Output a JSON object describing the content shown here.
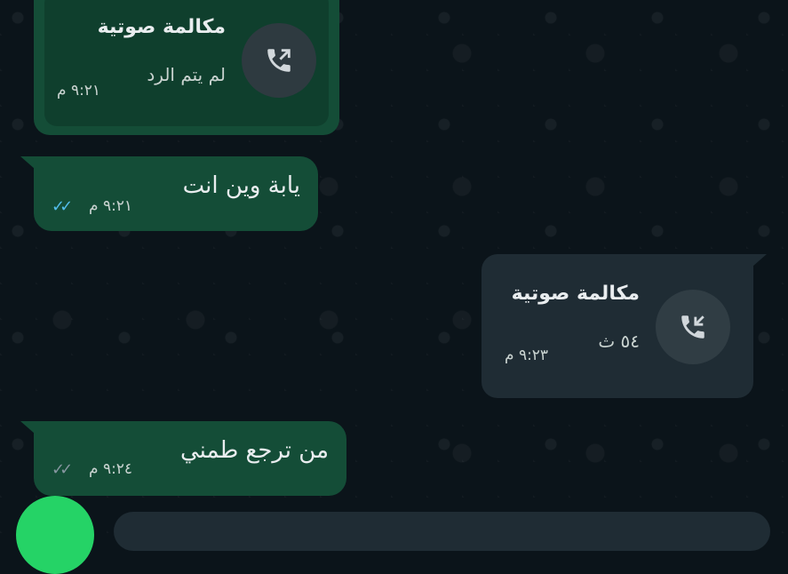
{
  "messages": [
    {
      "type": "call",
      "direction": "out",
      "title": "مكالمة صوتية",
      "status": "لم يتم الرد",
      "time": "٩:٢١ م",
      "icon": "outgoing-call-icon"
    },
    {
      "type": "text",
      "direction": "out",
      "text": "يابة وين انت",
      "time": "٩:٢١ م",
      "ticks": "✓✓",
      "ticks_color": "#53bdeb"
    },
    {
      "type": "call",
      "direction": "in",
      "title": "مكالمة صوتية",
      "duration": "٥٤ ث",
      "time": "٩:٢٣ م",
      "icon": "incoming-call-icon"
    },
    {
      "type": "text",
      "direction": "out",
      "text": "من ترجع طمني",
      "time": "٩:٢٤ م",
      "ticks": "✓✓",
      "ticks_color": "#8696a0"
    }
  ],
  "colors": {
    "background": "#0b141a",
    "outgoing_bubble": "#144d37",
    "incoming_bubble": "#1f2c34",
    "accent": "#25d366"
  }
}
